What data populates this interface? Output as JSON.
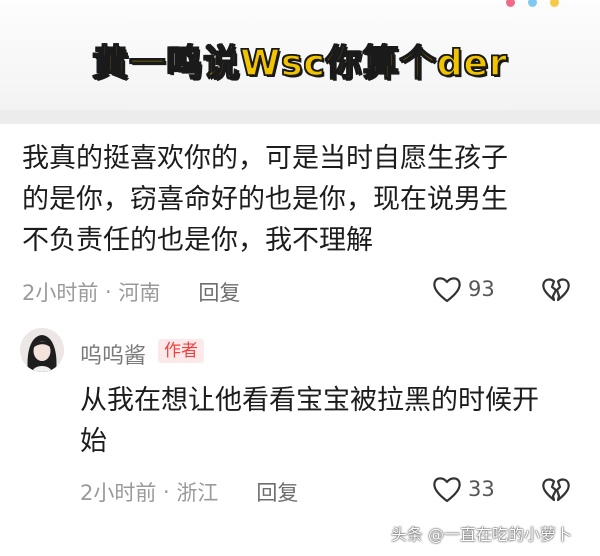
{
  "banner": {
    "title": "黄一鸣说Wsc你算个der"
  },
  "comment": {
    "text_lines": [
      "我真的挺喜欢你的，可是当时自愿生孩子",
      "的是你，窃喜命好的也是你，现在说男生",
      "不负责任的也是你，我不理解"
    ],
    "time": "2小时前",
    "location": "河南",
    "reply_label": "回复",
    "likes": "93",
    "icons": [
      "heart-icon",
      "broken-heart-icon"
    ]
  },
  "reply": {
    "username": "呜呜酱",
    "badge": "作者",
    "text_lines": [
      "从我在想让他看看宝宝被拉黑的时候开",
      "始"
    ],
    "time": "2小时前",
    "location": "浙江",
    "reply_label": "回复",
    "likes": "33"
  },
  "watermark": "头条 @一直在吃的小萝卜",
  "colors": {
    "banner_title": "#f2c400",
    "badge_text": "#f04142",
    "badge_bg": "#fde9e9",
    "meta_text": "#9a9a9a"
  }
}
